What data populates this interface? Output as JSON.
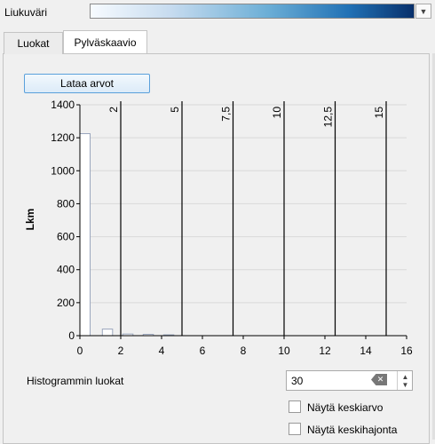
{
  "ramp": {
    "label": "Liukuväri",
    "dropdown_icon": "chevron-down-icon"
  },
  "tabs": [
    {
      "label": "Luokat",
      "active": false
    },
    {
      "label": "Pylväskaavio",
      "active": true
    }
  ],
  "load_button": "Lataa arvot",
  "bins": {
    "label": "Histogrammin luokat",
    "value": "30",
    "clear_icon": "backspace-clear-icon"
  },
  "checkboxes": {
    "mean": {
      "label": "Näytä keskiarvo",
      "checked": false
    },
    "stddev": {
      "label": "Näytä keskihajonta",
      "checked": false
    }
  },
  "chart_data": {
    "type": "bar",
    "ylabel": "Lkm",
    "xlabel": "",
    "xlim": [
      0,
      16
    ],
    "ylim": [
      0,
      1400
    ],
    "xticks": [
      0,
      2,
      4,
      6,
      8,
      10,
      12,
      14,
      16
    ],
    "yticks": [
      0,
      200,
      400,
      600,
      800,
      1000,
      1200,
      1400
    ],
    "grid": true,
    "bins": [
      {
        "x0": 0.0,
        "x1": 0.5,
        "value": 1225
      },
      {
        "x0": 1.1,
        "x1": 1.6,
        "value": 40
      },
      {
        "x0": 2.1,
        "x1": 2.6,
        "value": 10
      },
      {
        "x0": 3.1,
        "x1": 3.6,
        "value": 8
      },
      {
        "x0": 4.1,
        "x1": 4.6,
        "value": 5
      }
    ],
    "class_breaks": [
      {
        "value": 2,
        "label": "2"
      },
      {
        "value": 5,
        "label": "5"
      },
      {
        "value": 7.5,
        "label": "7,5"
      },
      {
        "value": 10,
        "label": "10"
      },
      {
        "value": 12.5,
        "label": "12,5"
      },
      {
        "value": 15,
        "label": "15"
      }
    ],
    "colors": {
      "bar_fill": "#ffffff",
      "bar_stroke": "#9aa6bd",
      "break_line": "#000000",
      "grid": "#d9d9d9",
      "plot_bg": "#f0f0f0"
    }
  }
}
